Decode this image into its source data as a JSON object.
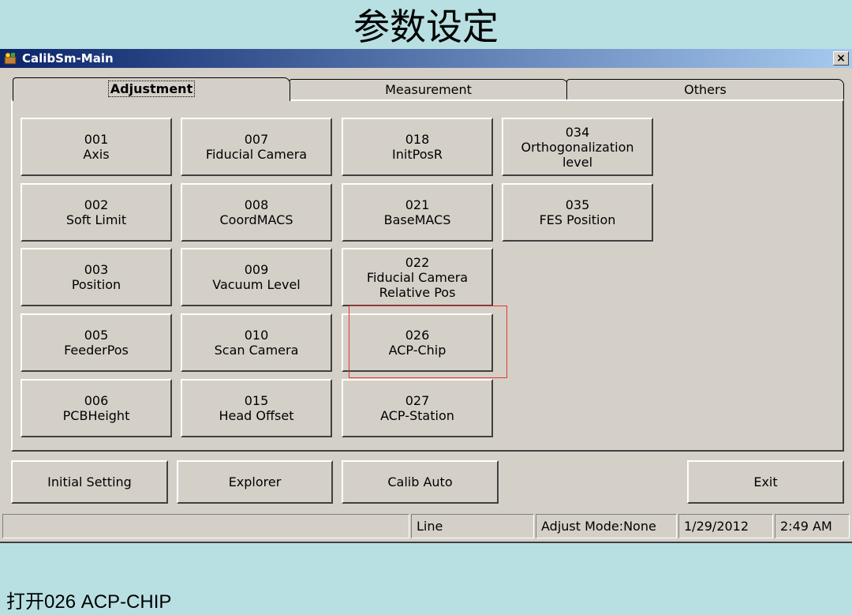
{
  "slide": {
    "title": "参数设定",
    "caption": "打开026 ACP-CHIP"
  },
  "window": {
    "title": "CalibSm-Main",
    "close_label": "×"
  },
  "tabs": [
    {
      "label": "Adjustment"
    },
    {
      "label": "Measurement"
    },
    {
      "label": "Others"
    }
  ],
  "grid": [
    [
      "001",
      "Axis"
    ],
    [
      "007",
      "Fiducial Camera"
    ],
    [
      "018",
      "InitPosR"
    ],
    [
      "034",
      "Orthogonalization level"
    ],
    [
      "002",
      "Soft Limit"
    ],
    [
      "008",
      "CoordMACS"
    ],
    [
      "021",
      "BaseMACS"
    ],
    [
      "035",
      "FES Position"
    ],
    [
      "003",
      "Position"
    ],
    [
      "009",
      "Vacuum Level"
    ],
    [
      "022",
      "Fiducial Camera Relative Pos"
    ],
    [
      "005",
      "FeederPos"
    ],
    [
      "010",
      "Scan Camera"
    ],
    [
      "026",
      "ACP-Chip"
    ],
    [
      "006",
      "PCBHeight"
    ],
    [
      "015",
      "Head Offset"
    ],
    [
      "027",
      "ACP-Station"
    ]
  ],
  "buttons": {
    "initial_setting": "Initial Setting",
    "explorer": "Explorer",
    "calib_auto": "Calib Auto",
    "exit": "Exit"
  },
  "status": {
    "line": "Line",
    "mode": "Adjust Mode:None",
    "date": "1/29/2012",
    "time": "2:49 AM"
  },
  "colors": {
    "highlight": "#e53333",
    "titlebar": "#0a246a"
  }
}
